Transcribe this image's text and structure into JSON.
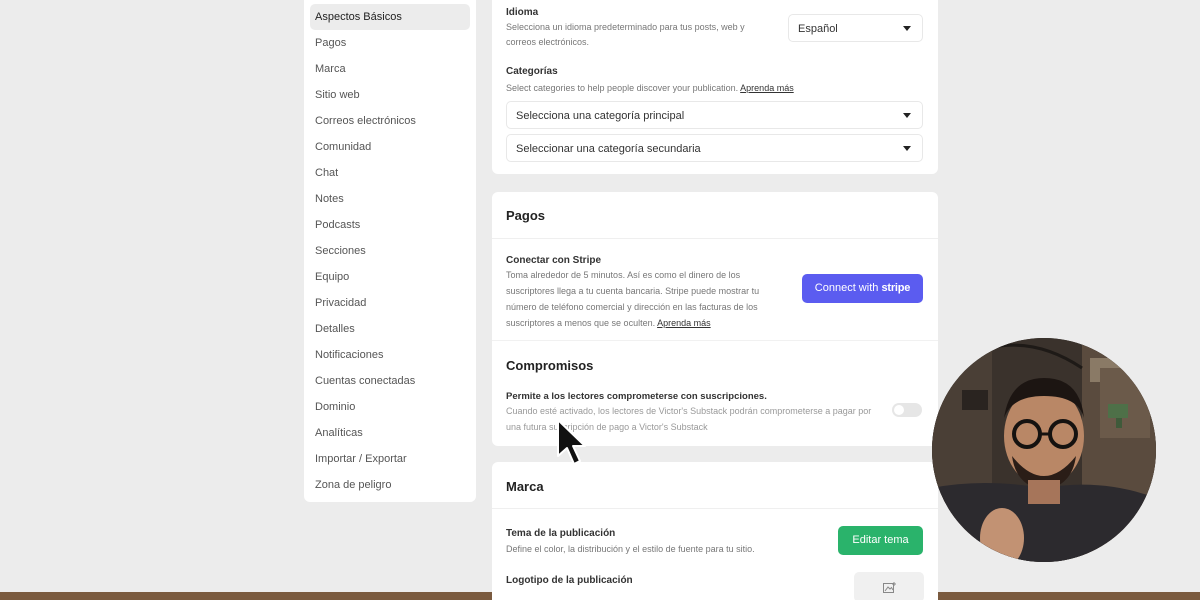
{
  "sidebar": {
    "items": [
      {
        "label": "Aspectos Básicos",
        "active": true
      },
      {
        "label": "Pagos"
      },
      {
        "label": "Marca"
      },
      {
        "label": "Sitio web"
      },
      {
        "label": "Correos electrónicos"
      },
      {
        "label": "Comunidad"
      },
      {
        "label": "Chat"
      },
      {
        "label": "Notes"
      },
      {
        "label": "Podcasts"
      },
      {
        "label": "Secciones"
      },
      {
        "label": "Equipo"
      },
      {
        "label": "Privacidad"
      },
      {
        "label": "Detalles"
      },
      {
        "label": "Notificaciones"
      },
      {
        "label": "Cuentas conectadas"
      },
      {
        "label": "Dominio"
      },
      {
        "label": "Analíticas"
      },
      {
        "label": "Importar / Exportar"
      },
      {
        "label": "Zona de peligro"
      }
    ]
  },
  "basics": {
    "language_label": "Idioma",
    "language_desc": "Selecciona un idioma predeterminado para tus posts, web y correos electrónicos.",
    "language_value": "Español",
    "categories_label": "Categorías",
    "categories_desc": "Select categories to help people discover your publication.",
    "categories_link": "Aprenda más",
    "primary_category_placeholder": "Selecciona una categoría principal",
    "secondary_category_placeholder": "Seleccionar una categoría secundaria"
  },
  "payments": {
    "title": "Pagos",
    "stripe_label": "Conectar con Stripe",
    "stripe_desc": "Toma alrededor de 5 minutos. Así es como el dinero de los suscriptores llega a tu cuenta bancaria. Stripe puede mostrar tu número de teléfono comercial y dirección en las facturas de los suscriptores a menos que se oculten.",
    "stripe_link": "Aprenda más",
    "connect_button_prefix": "Connect with",
    "connect_button_brand": "stripe"
  },
  "pledges": {
    "title": "Compromisos",
    "toggle_label": "Permite a los lectores comprometerse con suscripciones.",
    "toggle_desc": "Cuando esté activado, los lectores de Victor's Substack podrán comprometerse a pagar por una futura suscripción de pago a Victor's Substack",
    "enabled": false
  },
  "brand": {
    "title": "Marca",
    "theme_label": "Tema de la publicación",
    "theme_desc": "Define el color, la distribución y el estilo de fuente para tu sitio.",
    "edit_theme_button": "Editar tema",
    "logo_label": "Logotipo de la publicación"
  },
  "colors": {
    "stripe_button": "#5b5cf0",
    "theme_button": "#2ab36b",
    "page_background": "#ececec"
  }
}
